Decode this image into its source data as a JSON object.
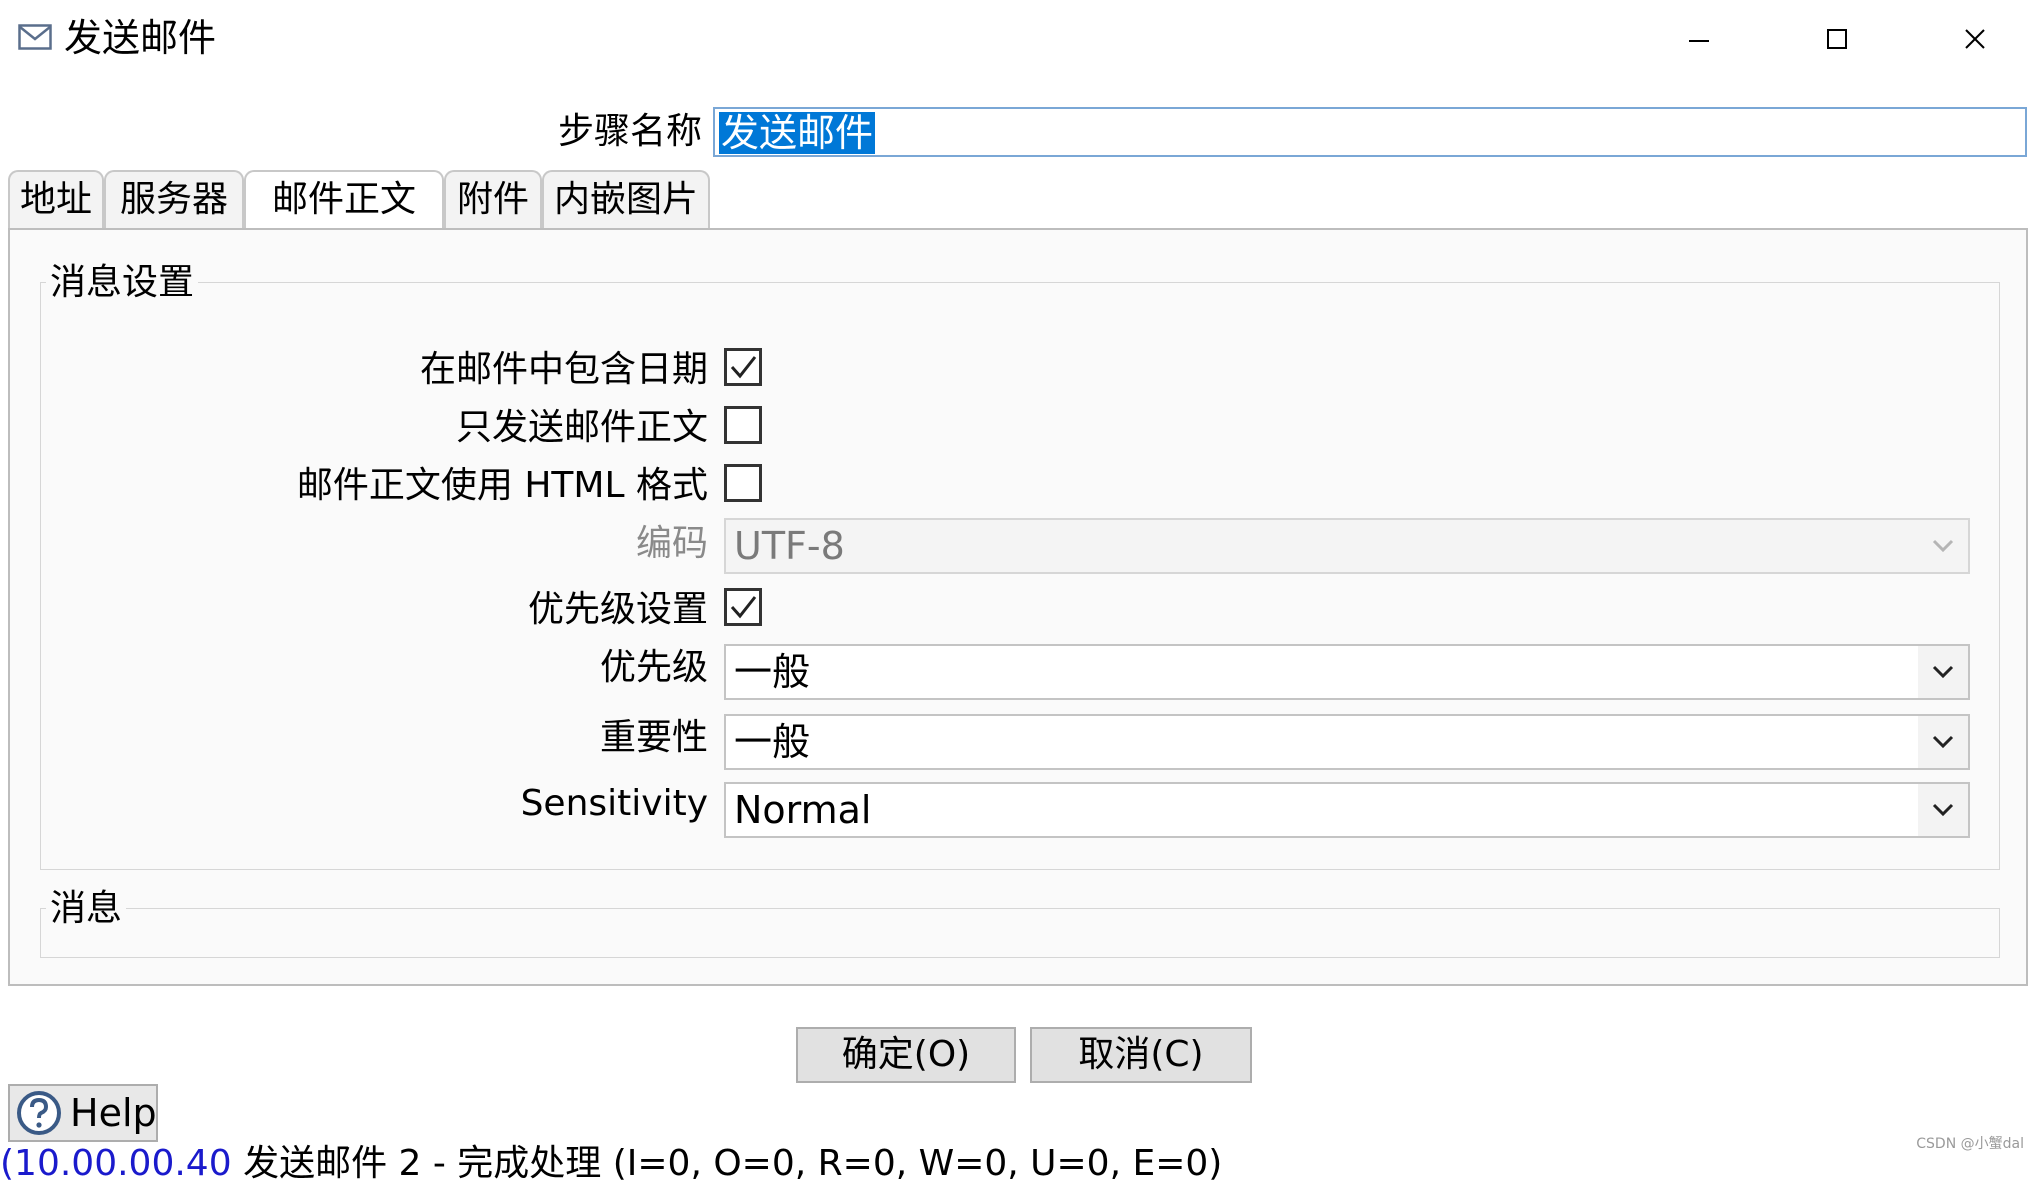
{
  "window": {
    "title": "发送邮件",
    "icon": "mail-envelope-icon",
    "controls": [
      "minimize-icon",
      "maximize-icon",
      "close-icon"
    ]
  },
  "step_name": {
    "label": "步骤名称",
    "value": "发送邮件"
  },
  "tabs": [
    {
      "label": "地址",
      "active": false
    },
    {
      "label": "服务器",
      "active": false
    },
    {
      "label": "邮件正文",
      "active": true
    },
    {
      "label": "附件",
      "active": false
    },
    {
      "label": "内嵌图片",
      "active": false
    }
  ],
  "message_settings": {
    "title": "消息设置",
    "include_date": {
      "label": "在邮件中包含日期",
      "checked": true
    },
    "only_body": {
      "label": "只发送邮件正文",
      "checked": false
    },
    "html_format": {
      "label": "邮件正文使用 HTML 格式",
      "checked": false
    },
    "encoding": {
      "label": "编码",
      "value": "UTF-8",
      "enabled": false
    },
    "priority_settings": {
      "label": "优先级设置",
      "checked": true
    },
    "priority": {
      "label": "优先级",
      "value": "一般"
    },
    "importance": {
      "label": "重要性",
      "value": "一般"
    },
    "sensitivity": {
      "label": "Sensitivity",
      "value": "Normal"
    }
  },
  "message_group": {
    "title": "消息"
  },
  "buttons": {
    "ok": "确定(O)",
    "cancel": "取消(C)",
    "help": "Help"
  },
  "log": {
    "time": "(10.00.00.40",
    "text": "发送邮件 2 - 完成处理 (I=0, O=0, R=0, W=0, U=0, E=0)"
  },
  "watermark": "CSDN @小蟹dal",
  "colors": {
    "selection": "#0078d7",
    "tab_border": "#c8c8c8",
    "button_face": "#e1e1e1"
  }
}
